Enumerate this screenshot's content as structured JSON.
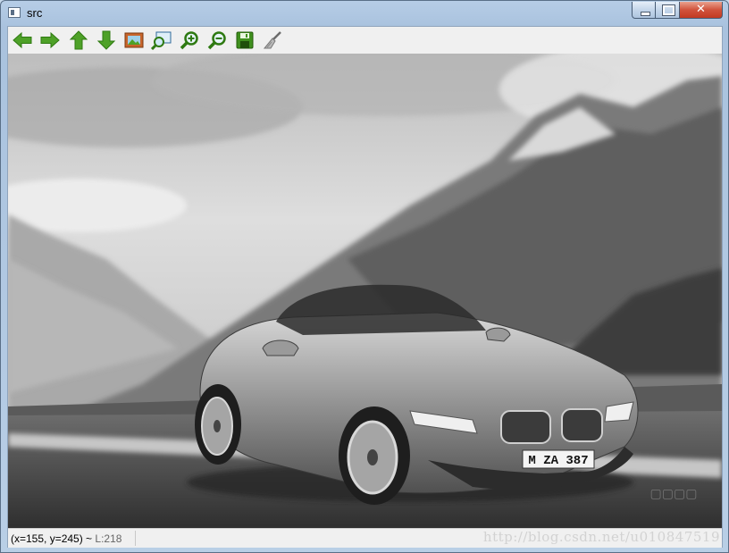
{
  "window": {
    "title": "src"
  },
  "toolbar": {
    "buttons": [
      {
        "icon": "arrow-left-icon"
      },
      {
        "icon": "arrow-right-icon"
      },
      {
        "icon": "arrow-up-icon"
      },
      {
        "icon": "arrow-down-icon"
      },
      {
        "icon": "image-icon"
      },
      {
        "icon": "zoom-fit-icon"
      },
      {
        "icon": "zoom-in-icon"
      },
      {
        "icon": "zoom-out-icon"
      },
      {
        "icon": "save-icon"
      },
      {
        "icon": "brush-icon"
      }
    ]
  },
  "image": {
    "plate": "M ZA 387",
    "watermark": "http://blog.csdn.net/u010847519"
  },
  "status": {
    "coords": "(x=155, y=245) ~",
    "level": "L:218"
  },
  "colors": {
    "icon_green": "#4ea128",
    "icon_dark_green": "#2f7a12",
    "titlebar": "#b6cde6",
    "close_red": "#c94a32"
  }
}
